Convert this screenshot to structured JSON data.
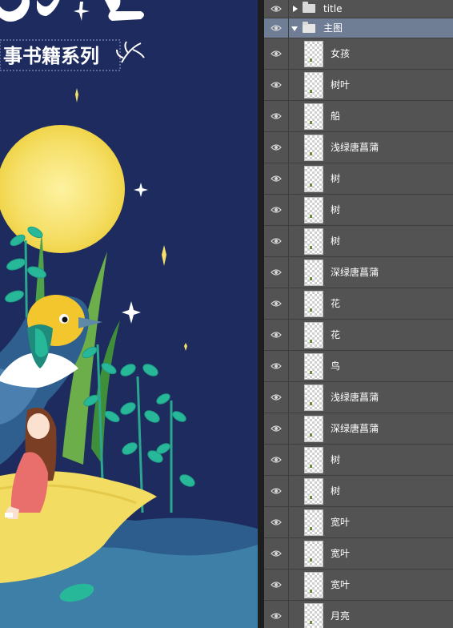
{
  "canvas": {
    "title_partial": "事书籍系列",
    "colors": {
      "sky": "#1d2b5e",
      "moon": "#f6e06a",
      "water": "#3d7fa6",
      "boat": "#f3dc62",
      "leaf": "#27b89a",
      "stem": "#2aa78e",
      "girl_dress": "#e86f6b",
      "hair": "#7a3e24"
    }
  },
  "layers": {
    "groups": [
      {
        "name": "title",
        "expanded": false
      },
      {
        "name": "主图",
        "expanded": true
      }
    ],
    "items": [
      {
        "name": "女孩"
      },
      {
        "name": "树叶"
      },
      {
        "name": "船"
      },
      {
        "name": "浅绿唐菖蒲"
      },
      {
        "name": "树"
      },
      {
        "name": "树"
      },
      {
        "name": "树"
      },
      {
        "name": "深绿唐菖蒲"
      },
      {
        "name": "花"
      },
      {
        "name": "花"
      },
      {
        "name": "鸟"
      },
      {
        "name": "浅绿唐菖蒲"
      },
      {
        "name": "深绿唐菖蒲"
      },
      {
        "name": "树"
      },
      {
        "name": "树"
      },
      {
        "name": "宽叶"
      },
      {
        "name": "宽叶"
      },
      {
        "name": "宽叶"
      },
      {
        "name": "月亮"
      }
    ]
  }
}
